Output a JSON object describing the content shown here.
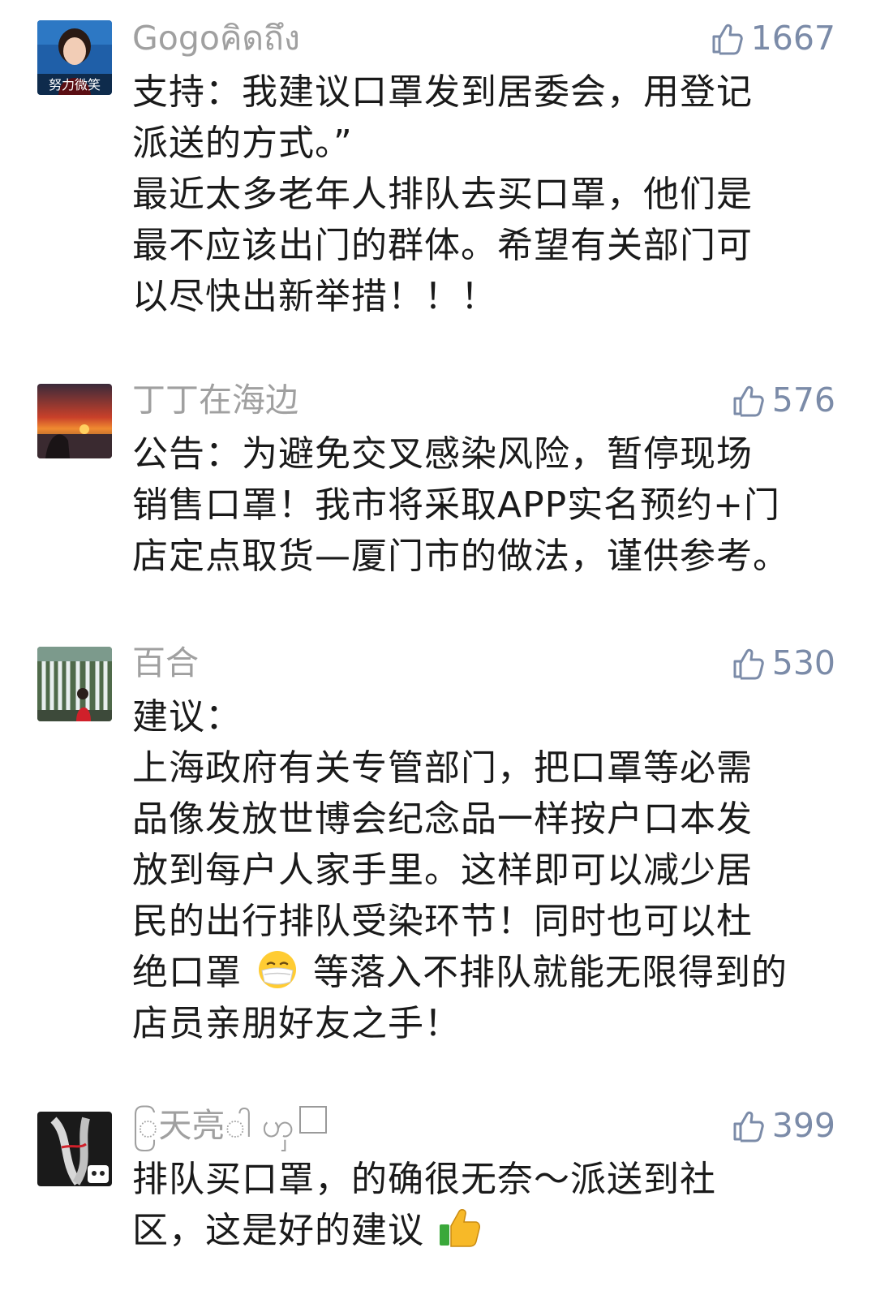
{
  "comments": [
    {
      "username": "Gogoคิดถึง",
      "likes": "1667",
      "avatar_caption": "努力微笑",
      "lines": [
        "支持：我建议口罩发到居委会，用登记",
        "派送的方式。”",
        "最近太多老年人排队去买口罩，他们是",
        "最不应该出门的群体。希望有关部门可",
        "以尽快出新举措！！！"
      ]
    },
    {
      "username": "丁丁在海边",
      "likes": "576",
      "lines": [
        "公告：为避免交叉感染风险，暂停现场",
        "销售口罩！我市将采取APP实名预约+门",
        "店定点取货—厦门市的做法，谨供参考。"
      ]
    },
    {
      "username": "百合",
      "likes": "530",
      "lines": [
        "建议：",
        "上海政府有关专管部门，把口罩等必需",
        "品像发放世博会纪念品一样按户口本发",
        "放到每户人家手里。这样即可以减少居",
        "民的出行排队受染环节！同时也可以杜",
        "绝口罩",
        "等落入不排队就能无限得到的",
        "店员亲朋好友之手！"
      ]
    },
    {
      "username": "ြ天亮ါ ၯ",
      "likes": "399",
      "lines": [
        "排队买口罩，的确很无奈～派送到社",
        "区，这是好的建议"
      ]
    }
  ],
  "icons": {
    "like": "thumbs-up-outline-icon",
    "mask_emoji": "mask-face-emoji",
    "thumbs_up_emoji": "thumbs-up-emoji",
    "square": "square-box-icon"
  },
  "colors": {
    "username": "#a0a0a0",
    "likes": "#7b8ba8",
    "text": "#1a1a1a",
    "background": "#ffffff"
  }
}
